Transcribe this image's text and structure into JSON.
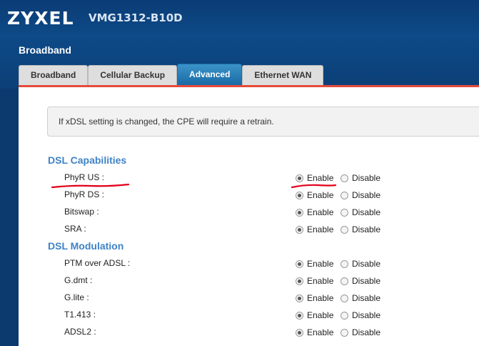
{
  "header": {
    "brand": "ZYXEL",
    "model": "VMG1312-B10D",
    "section_title": "Broadband"
  },
  "tabs": [
    {
      "label": "Broadband"
    },
    {
      "label": "Cellular Backup"
    },
    {
      "label": "Advanced",
      "active": true
    },
    {
      "label": "Ethernet WAN"
    }
  ],
  "note": "If xDSL setting is changed, the CPE will require a retrain.",
  "option_labels": {
    "enable": "Enable",
    "disable": "Disable"
  },
  "capabilities": {
    "heading": "DSL Capabilities",
    "items": [
      {
        "label": "PhyR US :",
        "value": "Enable"
      },
      {
        "label": "PhyR DS :",
        "value": "Enable"
      },
      {
        "label": "Bitswap :",
        "value": "Enable"
      },
      {
        "label": "SRA :",
        "value": "Enable"
      }
    ]
  },
  "modulation": {
    "heading": "DSL Modulation",
    "items": [
      {
        "label": "PTM over ADSL :",
        "value": "Enable"
      },
      {
        "label": "G.dmt :",
        "value": "Enable"
      },
      {
        "label": "G.lite :",
        "value": "Enable"
      },
      {
        "label": "T1.413 :",
        "value": "Enable"
      },
      {
        "label": "ADSL2 :",
        "value": "Enable"
      }
    ]
  },
  "colors": {
    "header_bg": "#0d4a87",
    "active_tab": "#2a7fb9",
    "accent_line": "#e64a3a",
    "heading": "#3f82c7",
    "annotation": "#e3001b"
  }
}
